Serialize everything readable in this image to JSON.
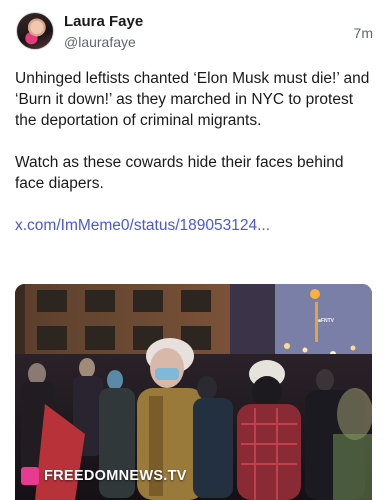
{
  "post": {
    "author": {
      "display_name": "Laura Faye",
      "handle": "@laurafaye"
    },
    "timestamp": "7m",
    "paragraphs": [
      "Unhinged leftists chanted ‘Elon Musk must die!’ and ‘Burn it down!’ as they marched in NYC to protest the deportation of criminal migrants.",
      "Watch as these cowards hide their faces behind face diapers."
    ],
    "link_text": "x.com/ImMeme0/status/189053124...",
    "media": {
      "watermark": "FREEDOMNEWS.TV",
      "badge": "■FNTV"
    }
  },
  "colors": {
    "link": "#4a58d9",
    "muted": "#606770",
    "watermark_icon": "#e83a8e"
  }
}
